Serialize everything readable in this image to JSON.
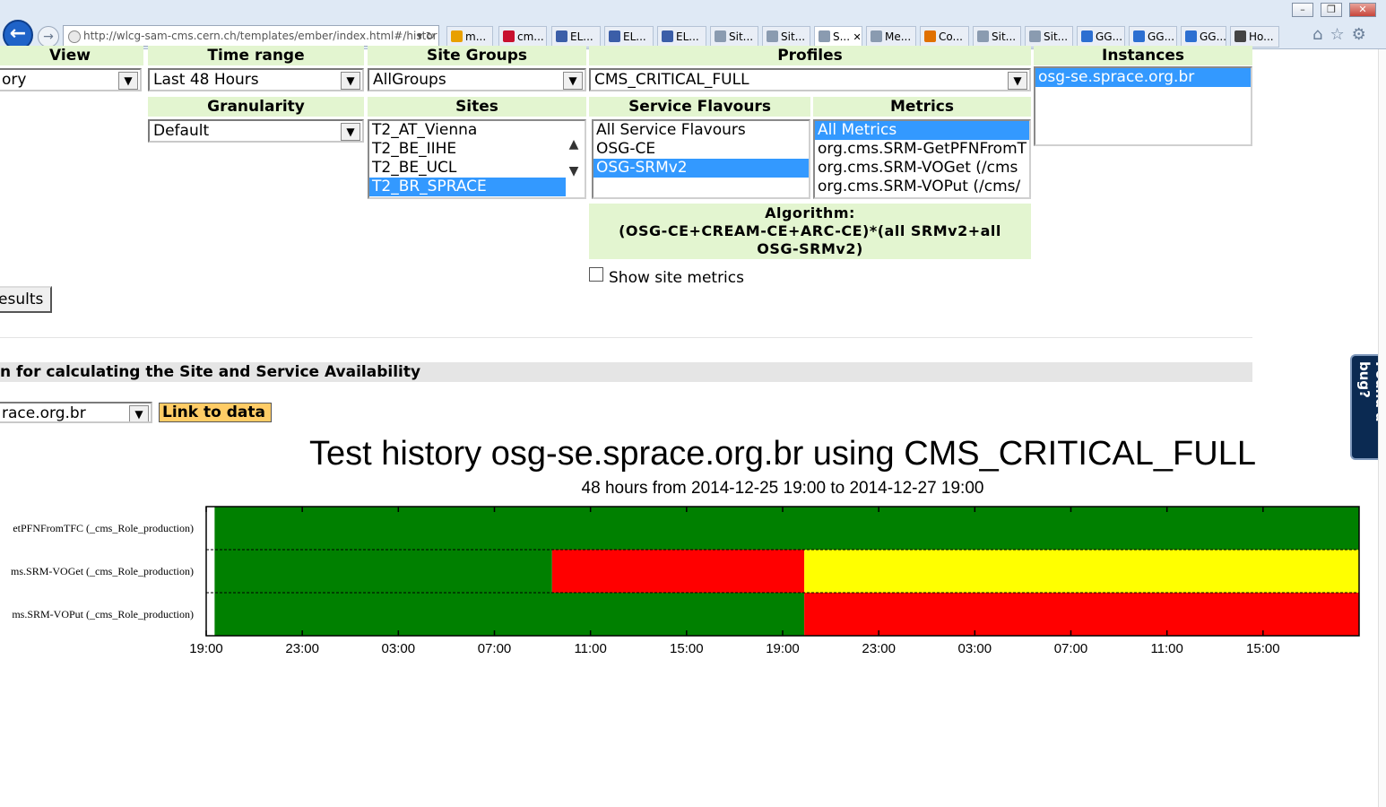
{
  "browser": {
    "url": "http://wlcg-sam-cms.cern.ch/templates/ember/index.html#/histor",
    "window_buttons": [
      "–",
      "❐",
      "✕"
    ],
    "tabs": [
      {
        "label": "m...",
        "icon": "orange-tab-icon",
        "color": "#e8a000"
      },
      {
        "label": "cm...",
        "icon": "target-tab-icon",
        "color": "#c8102e"
      },
      {
        "label": "EL...",
        "icon": "elog-tab-icon",
        "color": "#3b5ea8"
      },
      {
        "label": "EL...",
        "icon": "elog-tab-icon",
        "color": "#3b5ea8"
      },
      {
        "label": "EL...",
        "icon": "elog-tab-icon",
        "color": "#3b5ea8"
      },
      {
        "label": "Sit...",
        "icon": "globe-tab-icon",
        "color": "#8a9bb0"
      },
      {
        "label": "Sit...",
        "icon": "globe-tab-icon",
        "color": "#8a9bb0"
      },
      {
        "label": "S...",
        "icon": "globe-tab-icon",
        "color": "#8a9bb0",
        "active": true,
        "close": "✕"
      },
      {
        "label": "Me...",
        "icon": "globe-tab-icon",
        "color": "#8a9bb0"
      },
      {
        "label": "Co...",
        "icon": "ticket-tab-icon",
        "color": "#e07000"
      },
      {
        "label": "Sit...",
        "icon": "globe-tab-icon",
        "color": "#8a9bb0"
      },
      {
        "label": "Sit...",
        "icon": "globe-tab-icon",
        "color": "#8a9bb0"
      },
      {
        "label": "GG...",
        "icon": "ie-tab-icon",
        "color": "#2c6fd1"
      },
      {
        "label": "GG...",
        "icon": "ie-tab-icon",
        "color": "#2c6fd1"
      },
      {
        "label": "GG...",
        "icon": "ie-tab-icon",
        "color": "#2c6fd1"
      },
      {
        "label": "Ho...",
        "icon": "people-tab-icon",
        "color": "#444444"
      }
    ],
    "toolbar_icons": [
      "⌂",
      "☆",
      "⚙"
    ]
  },
  "filters": {
    "view": {
      "header": "View",
      "value": "ory"
    },
    "time_range": {
      "header": "Time range",
      "value": "Last 48 Hours"
    },
    "site_groups": {
      "header": "Site Groups",
      "value": "AllGroups"
    },
    "profiles": {
      "header": "Profiles",
      "value": "CMS_CRITICAL_FULL"
    },
    "instances": {
      "header": "Instances",
      "options": [
        "osg-se.sprace.org.br"
      ],
      "selected": 0
    },
    "granularity": {
      "header": "Granularity",
      "value": "Default"
    },
    "sites": {
      "header": "Sites",
      "options": [
        "T2_AT_Vienna",
        "T2_BE_IIHE",
        "T2_BE_UCL",
        "T2_BR_SPRACE"
      ],
      "selected": 3
    },
    "service_flavours": {
      "header": "Service Flavours",
      "options": [
        "All Service Flavours",
        "OSG-CE",
        "OSG-SRMv2"
      ],
      "selected": 2
    },
    "metrics": {
      "header": "Metrics",
      "options": [
        "All Metrics",
        "org.cms.SRM-GetPFNFromT",
        "org.cms.SRM-VOGet (/cms",
        "org.cms.SRM-VOPut (/cms/"
      ],
      "selected": 0
    },
    "algorithm": {
      "label": "Algorithm:",
      "line1": "(OSG-CE+CREAM-CE+ARC-CE)*(all SRMv2+all",
      "line2": "OSG-SRMv2)"
    },
    "show_site_metrics": "Show site metrics",
    "results_button": "esults"
  },
  "algorithm_section": {
    "title": "n for calculating the Site and Service Availability",
    "instance_value": "race.org.br",
    "link_to_data": "Link to data"
  },
  "feedback": {
    "label": "Found a bug?"
  },
  "chart_data": {
    "type": "heatmap",
    "title": "Test history osg-se.sprace.org.br using CMS_CRITICAL_FULL",
    "subtitle": "48 hours from 2014-12-25 19:00 to 2014-12-27 19:00",
    "x_range_hours": [
      0,
      48
    ],
    "tick_labels": [
      "19:00",
      "23:00",
      "03:00",
      "07:00",
      "11:00",
      "15:00",
      "19:00",
      "23:00",
      "03:00",
      "07:00",
      "11:00",
      "15:00"
    ],
    "tick_hours": [
      0,
      4,
      8,
      12,
      16,
      20,
      24,
      28,
      32,
      36,
      40,
      44
    ],
    "colors": {
      "ok": "#008000",
      "critical": "#ff0000",
      "warning": "#ffff00",
      "unknown": "#ffffff"
    },
    "rows": [
      {
        "label": "etPFNFromTFC (_cms_Role_production)",
        "segments": [
          {
            "start": 0,
            "end": 0.35,
            "status": "unknown"
          },
          {
            "start": 0.35,
            "end": 48,
            "status": "ok"
          }
        ]
      },
      {
        "label": "ms.SRM-VOGet (_cms_Role_production)",
        "segments": [
          {
            "start": 0,
            "end": 0.35,
            "status": "unknown"
          },
          {
            "start": 0.35,
            "end": 14.4,
            "status": "ok"
          },
          {
            "start": 14.4,
            "end": 24.9,
            "status": "critical"
          },
          {
            "start": 24.9,
            "end": 48,
            "status": "warning"
          }
        ]
      },
      {
        "label": "ms.SRM-VOPut (_cms_Role_production)",
        "segments": [
          {
            "start": 0,
            "end": 0.35,
            "status": "unknown"
          },
          {
            "start": 0.35,
            "end": 24.9,
            "status": "ok"
          },
          {
            "start": 24.9,
            "end": 48,
            "status": "critical"
          }
        ]
      }
    ]
  }
}
